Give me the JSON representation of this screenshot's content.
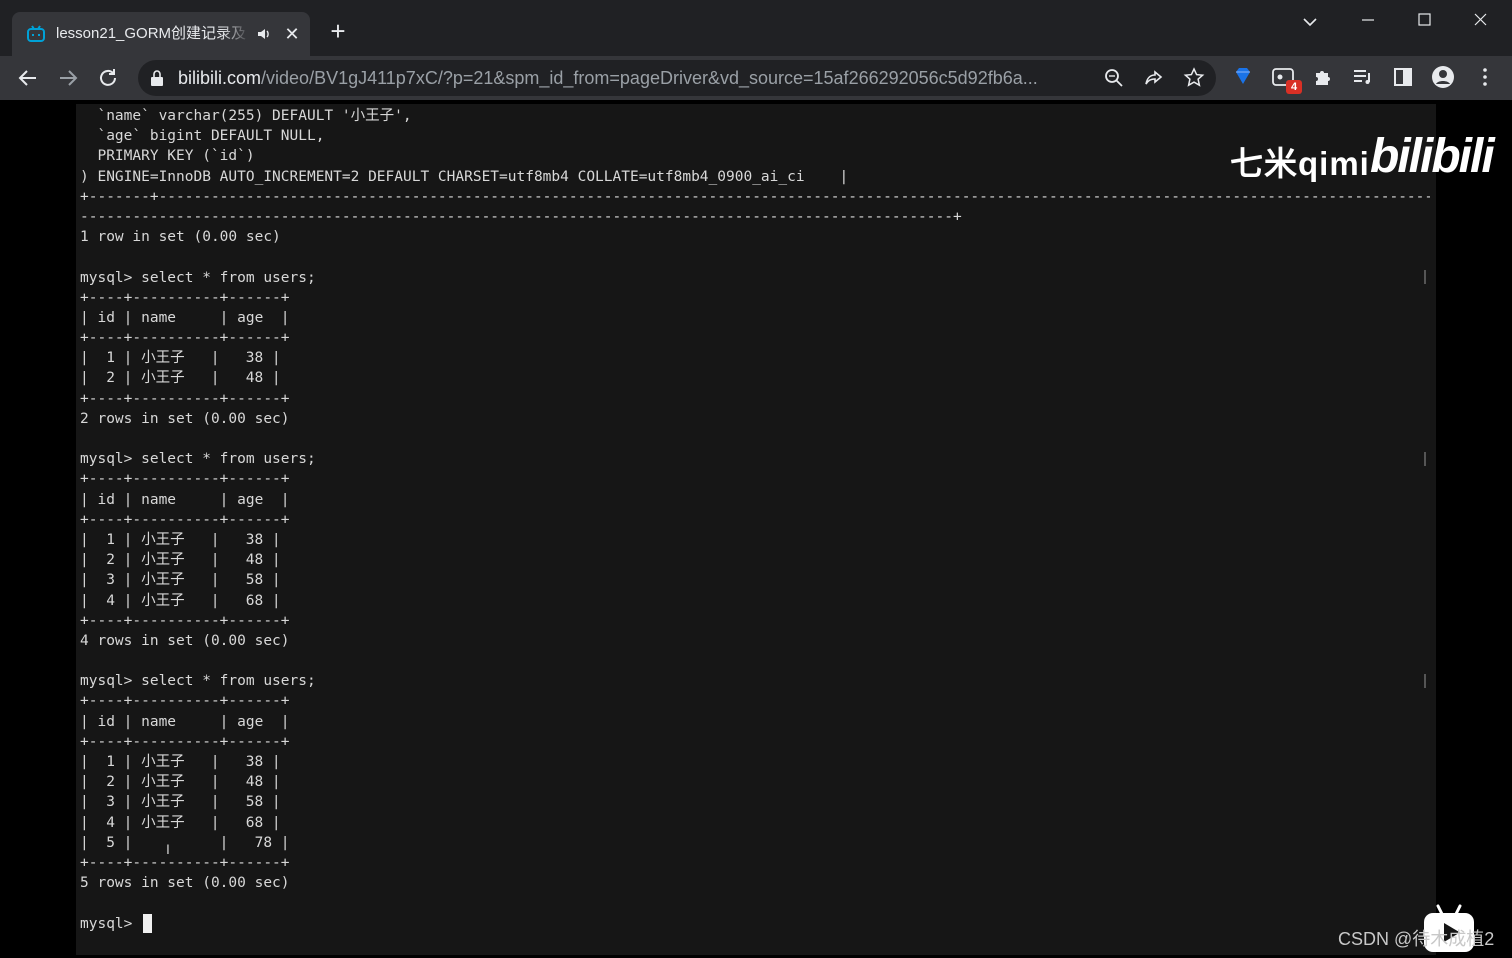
{
  "browser": {
    "tab_title": "lesson21_GORM创建记录及",
    "tab_audio_icon": "speaker-icon",
    "url_host": "bilibili.com",
    "url_path": "/video/BV1gJ411p7xC/?p=21&spm_id_from=pageDriver&vd_source=15af266292056c5d92fb6a...",
    "extension_badge": "4",
    "colors": {
      "tabbar": "#202124",
      "toolbar": "#35363a",
      "accent": "#00a1d6"
    }
  },
  "video": {
    "watermark_qimi": "七米qimi",
    "watermark_bilibili": "bilibili",
    "csdn_watermark": "CSDN @待木成植2"
  },
  "terminal": {
    "lines": [
      "  `name` varchar(255) DEFAULT '小王子',",
      "  `age` bigint DEFAULT NULL,",
      "  PRIMARY KEY (`id`)",
      ") ENGINE=InnoDB AUTO_INCREMENT=2 DEFAULT CHARSET=utf8mb4 COLLATE=utf8mb4_0900_ai_ci    |",
      "+-------+-------------------------------------------------------------------------------------------------------------------------------------------------------------",
      "----------------------------------------------------------------------------------------------------+",
      "1 row in set (0.00 sec)",
      "",
      "mysql> select * from users;",
      "+----+----------+------+",
      "| id | name     | age  |",
      "+----+----------+------+",
      "|  1 | 小王子   |   38 |",
      "|  2 | 小王子   |   48 |",
      "+----+----------+------+",
      "2 rows in set (0.00 sec)",
      "",
      "mysql> select * from users;",
      "+----+----------+------+",
      "| id | name     | age  |",
      "+----+----------+------+",
      "|  1 | 小王子   |   38 |",
      "|  2 | 小王子   |   48 |",
      "|  3 | 小王子   |   58 |",
      "|  4 | 小王子   |   68 |",
      "+----+----------+------+",
      "4 rows in set (0.00 sec)",
      "",
      "mysql> select * from users;",
      "+----+----------+------+",
      "| id | name     | age  |",
      "+----+----------+------+",
      "|  1 | 小王子   |   38 |",
      "|  2 | 小王子   |   48 |",
      "|  3 | 小王子   |   58 |",
      "|  4 | 小王子   |   68 |",
      "|  5 |          |   78 |",
      "+----+----------+------+",
      "5 rows in set (0.00 sec)",
      "",
      "mysql> "
    ]
  }
}
